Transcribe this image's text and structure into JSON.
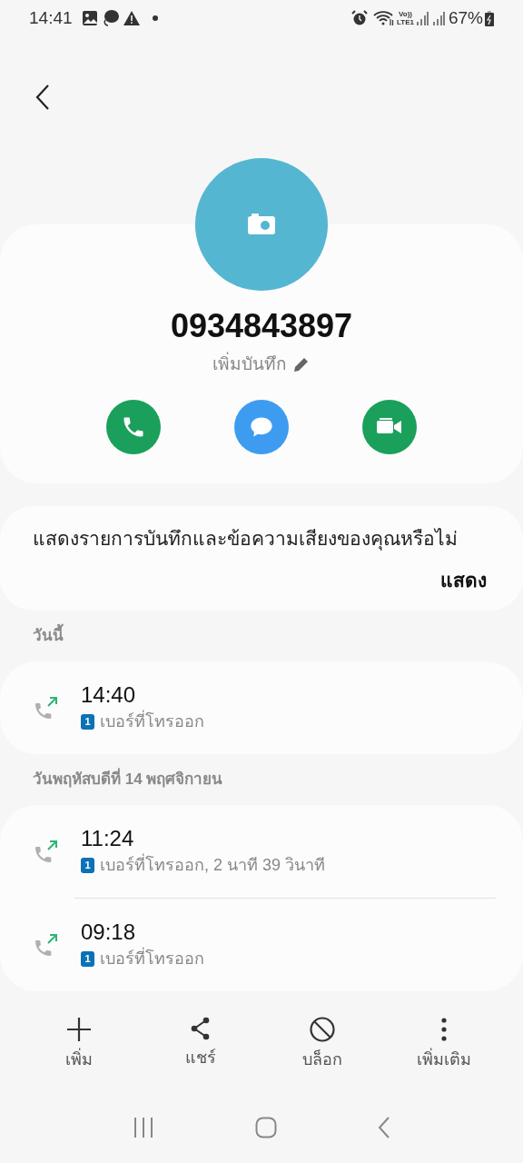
{
  "status_bar": {
    "time": "14:41",
    "volte": "Vo))",
    "lte": "LTE1",
    "battery": "67%"
  },
  "contact": {
    "number": "0934843897",
    "add_note": "เพิ่มบันทึก"
  },
  "actions": [
    {
      "kind": "call"
    },
    {
      "kind": "message"
    },
    {
      "kind": "video"
    }
  ],
  "recordings_prompt": {
    "text": "แสดงรายการบันทึกและข้อความเสียงของคุณหรือไม่",
    "button": "แสดง"
  },
  "call_groups": [
    {
      "header": "วันนี้",
      "calls": [
        {
          "time": "14:40",
          "sim": "1",
          "detail": "เบอร์ที่โทรออก"
        }
      ]
    },
    {
      "header": "วันพฤหัสบดีที่ 14 พฤศจิกายน",
      "calls": [
        {
          "time": "11:24",
          "sim": "1",
          "detail": "เบอร์ที่โทรออก, 2 นาที 39 วินาที"
        },
        {
          "time": "09:18",
          "sim": "1",
          "detail": "เบอร์ที่โทรออก"
        }
      ]
    }
  ],
  "bottom_bar": [
    {
      "kind": "add",
      "label": "เพิ่ม"
    },
    {
      "kind": "share",
      "label": "แชร์"
    },
    {
      "kind": "block",
      "label": "บล็อก"
    },
    {
      "kind": "more",
      "label": "เพิ่มเติม"
    }
  ]
}
